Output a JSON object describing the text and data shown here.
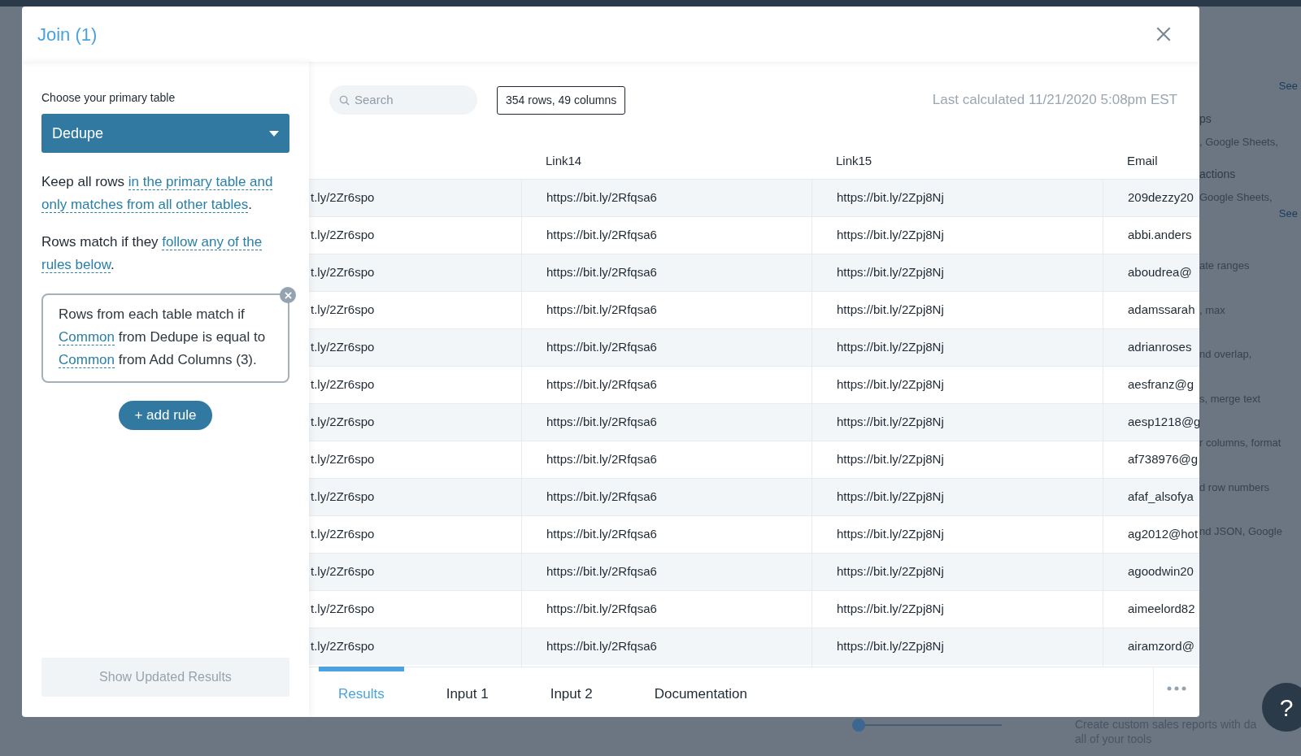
{
  "background": {
    "right_texts": [
      {
        "kind": "link",
        "text": "See"
      },
      {
        "kind": "heading",
        "text": "ps"
      },
      {
        "kind": "text",
        "text": ", Google Sheets,"
      },
      {
        "kind": "heading",
        "text": "actions"
      },
      {
        "kind": "text",
        "text": "Google Sheets,"
      },
      {
        "kind": "link",
        "text": "See"
      },
      {
        "kind": "text",
        "text": "ate ranges"
      },
      {
        "kind": "text",
        "text": ", max"
      },
      {
        "kind": "text",
        "text": "nd overlap,"
      },
      {
        "kind": "text",
        "text": "s, merge text"
      },
      {
        "kind": "text",
        "text": "r columns, format"
      },
      {
        "kind": "text",
        "text": "d row numbers"
      },
      {
        "kind": "text",
        "text": "nd JSON, Google"
      }
    ],
    "bottom_texts": [
      "Create custom sales reports with da",
      "all of your tools"
    ],
    "slider": {
      "level": 0
    },
    "help": "?"
  },
  "dialog": {
    "title": "Join (1)",
    "primary_label": "Choose your primary table",
    "primary_value": "Dedupe",
    "keep_rule": [
      {
        "kind": "text",
        "text": "Keep all rows "
      },
      {
        "kind": "link",
        "text": "in the primary table and"
      },
      {
        "kind": "break"
      },
      {
        "kind": "link",
        "text": "only matches from all other tables"
      },
      {
        "kind": "text",
        "text": "."
      }
    ],
    "match_rule": [
      {
        "kind": "text",
        "text": "Rows match if they "
      },
      {
        "kind": "link",
        "text": "follow any of the"
      },
      {
        "kind": "break"
      },
      {
        "kind": "link",
        "text": "rules below"
      },
      {
        "kind": "text",
        "text": "."
      }
    ],
    "rules": [
      [
        {
          "kind": "text",
          "text": "Rows from each table match if "
        },
        {
          "kind": "link",
          "text": "Common"
        },
        {
          "kind": "text",
          "text": " from Dedupe is equal to "
        },
        {
          "kind": "link",
          "text": "Common"
        },
        {
          "kind": "text",
          "text": " from Add Columns (3)."
        }
      ]
    ],
    "add_rule": "+ add rule",
    "show_results": {
      "label": "Show Updated Results",
      "disabled": true
    },
    "search": {
      "placeholder": "Search"
    },
    "count": "354 rows, 49 columns",
    "last_calculated": "Last calculated 11/21/2020 5:08pm EST",
    "table": {
      "columns": [
        "",
        "Link14",
        "Link15",
        "Email"
      ],
      "rows": [
        [
          "t.ly/2Zr6spo",
          "https://bit.ly/2Rfqsa6",
          "https://bit.ly/2Zpj8Nj",
          "209dezzy20"
        ],
        [
          "t.ly/2Zr6spo",
          "https://bit.ly/2Rfqsa6",
          "https://bit.ly/2Zpj8Nj",
          "abbi.anders"
        ],
        [
          "t.ly/2Zr6spo",
          "https://bit.ly/2Rfqsa6",
          "https://bit.ly/2Zpj8Nj",
          "aboudrea@"
        ],
        [
          "t.ly/2Zr6spo",
          "https://bit.ly/2Rfqsa6",
          "https://bit.ly/2Zpj8Nj",
          "adamssarah"
        ],
        [
          "t.ly/2Zr6spo",
          "https://bit.ly/2Rfqsa6",
          "https://bit.ly/2Zpj8Nj",
          "adrianroses"
        ],
        [
          "t.ly/2Zr6spo",
          "https://bit.ly/2Rfqsa6",
          "https://bit.ly/2Zpj8Nj",
          "aesfranz@g"
        ],
        [
          "t.ly/2Zr6spo",
          "https://bit.ly/2Rfqsa6",
          "https://bit.ly/2Zpj8Nj",
          "aesp1218@g"
        ],
        [
          "t.ly/2Zr6spo",
          "https://bit.ly/2Rfqsa6",
          "https://bit.ly/2Zpj8Nj",
          "af738976@g"
        ],
        [
          "t.ly/2Zr6spo",
          "https://bit.ly/2Rfqsa6",
          "https://bit.ly/2Zpj8Nj",
          "afaf_alsofya"
        ],
        [
          "t.ly/2Zr6spo",
          "https://bit.ly/2Rfqsa6",
          "https://bit.ly/2Zpj8Nj",
          "ag2012@hot"
        ],
        [
          "t.ly/2Zr6spo",
          "https://bit.ly/2Rfqsa6",
          "https://bit.ly/2Zpj8Nj",
          "agoodwin20"
        ],
        [
          "t.ly/2Zr6spo",
          "https://bit.ly/2Rfqsa6",
          "https://bit.ly/2Zpj8Nj",
          "aimeelord82"
        ],
        [
          "t.ly/2Zr6spo",
          "https://bit.ly/2Rfqsa6",
          "https://bit.ly/2Zpj8Nj",
          "airamzord@"
        ]
      ]
    },
    "tabs": [
      {
        "label": "Results",
        "selected": true
      },
      {
        "label": "Input 1",
        "selected": false
      },
      {
        "label": "Input 2",
        "selected": false
      },
      {
        "label": "Documentation",
        "selected": false
      }
    ]
  }
}
